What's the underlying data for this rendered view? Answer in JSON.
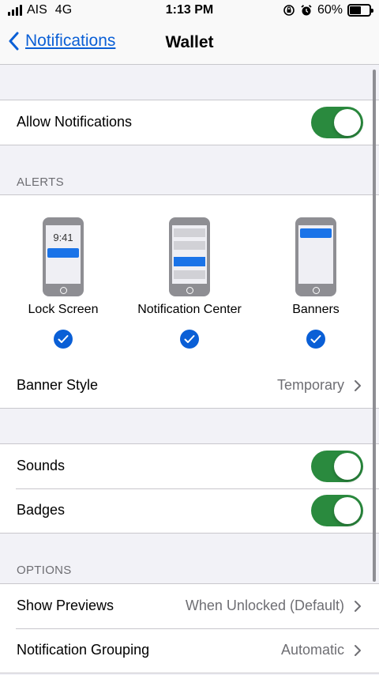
{
  "status_bar": {
    "carrier": "AIS",
    "network": "4G",
    "time": "1:13 PM",
    "battery_text": "60%",
    "battery_level": 0.6
  },
  "nav": {
    "back_label": "Notifications",
    "title": "Wallet"
  },
  "allow_notifications": {
    "label": "Allow Notifications",
    "on": true
  },
  "alerts": {
    "header": "ALERTS",
    "lock_screen": {
      "label": "Lock Screen",
      "time": "9:41",
      "checked": true
    },
    "notification_center": {
      "label": "Notification Center",
      "checked": true
    },
    "banners": {
      "label": "Banners",
      "checked": true
    }
  },
  "banner_style": {
    "label": "Banner Style",
    "value": "Temporary"
  },
  "sounds": {
    "label": "Sounds",
    "on": true
  },
  "badges": {
    "label": "Badges",
    "on": true
  },
  "options": {
    "header": "OPTIONS",
    "show_previews": {
      "label": "Show Previews",
      "value": "When Unlocked (Default)"
    },
    "notification_grouping": {
      "label": "Notification Grouping",
      "value": "Automatic"
    }
  },
  "colors": {
    "accent": "#0a5fd6",
    "toggle_on": "#2a8a3e",
    "banner_highlight": "#1a73e8"
  }
}
